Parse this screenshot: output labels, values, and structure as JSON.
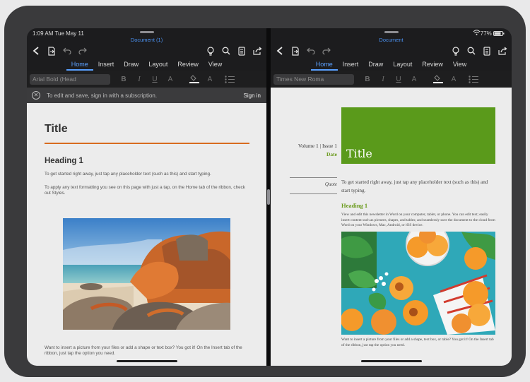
{
  "left": {
    "status": {
      "time": "1:09 AM",
      "date": "Tue May 11"
    },
    "doc_title": "Document (1)",
    "tabs": [
      "Home",
      "Insert",
      "Draw",
      "Layout",
      "Review",
      "View"
    ],
    "active_tab": "Home",
    "font_name": "Arial Bold (Head",
    "format_buttons": [
      "B",
      "I",
      "U",
      "A",
      "A"
    ],
    "banner": {
      "message": "To edit and save, sign in with a subscription.",
      "sign_in": "Sign in"
    },
    "document": {
      "title": "Title",
      "heading": "Heading 1",
      "para1": "To get started right away, just tap any placeholder text (such as this) and start typing.",
      "para2": "To apply any text formatting you see on this page with just a tap, on the Home tab of the ribbon, check out Styles.",
      "para3": "Want to insert a picture from your files or add a shape or text box? You got it! On the Insert tab of the ribbon, just tap the option you need."
    }
  },
  "right": {
    "status": {
      "battery": "77%"
    },
    "doc_title": "Document",
    "tabs": [
      "Home",
      "Insert",
      "Draw",
      "Layout",
      "Review",
      "View"
    ],
    "active_tab": "Home",
    "font_name": "Times New Roma",
    "format_buttons": [
      "B",
      "I",
      "U",
      "A",
      "A"
    ],
    "document": {
      "title": "Title",
      "volume": "Volume 1 | Issue 1",
      "date": "Date",
      "quote": "Quote",
      "intro": "To get started right away, just tap any placeholder text (such as this) and start typing.",
      "heading": "Heading 1",
      "body": "View and edit this newsletter in Word on your computer, tablet, or phone. You can edit text; easily insert content such as pictures, shapes, and tables; and seamlessly save the document to the cloud from Word on your Windows, Mac, Android, or iOS device.",
      "caption": "Want to insert a picture from your files or add a shape, text box, or table? You got it! On the Insert tab of the ribbon, just tap the option you need."
    }
  },
  "colors": {
    "accent_blue": "#5aa0ff",
    "title_rule": "#d86c1f",
    "newsletter_green": "#5a9a1b"
  }
}
